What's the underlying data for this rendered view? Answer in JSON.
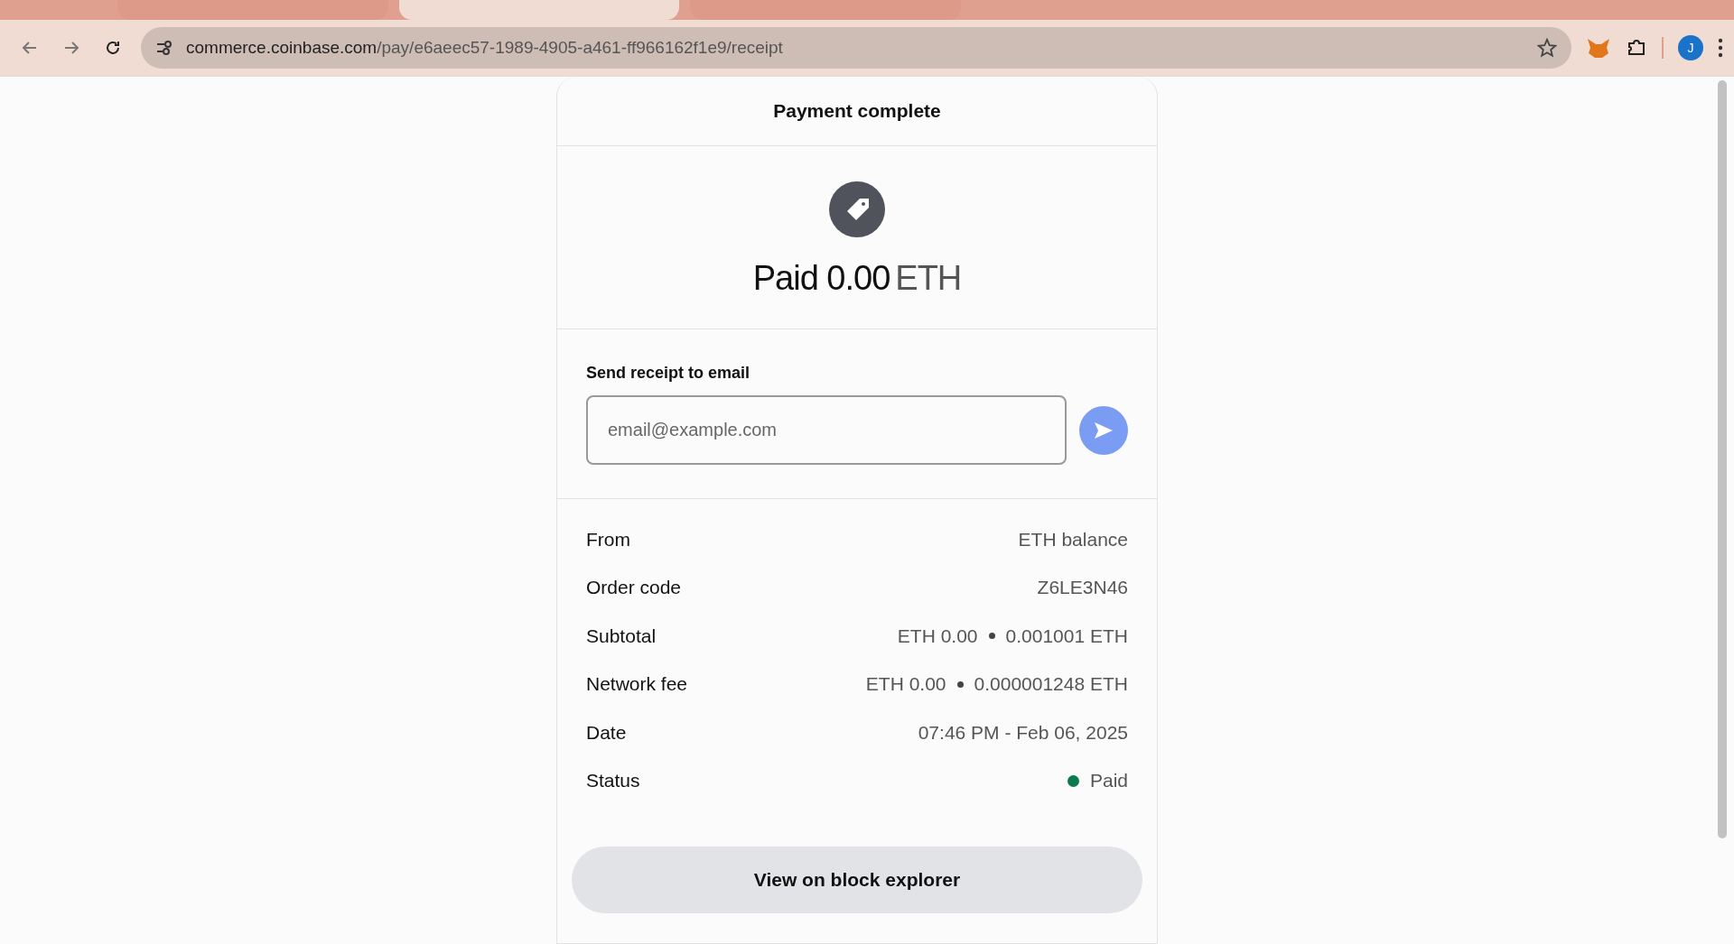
{
  "browser": {
    "tabs": [
      {
        "selected": false
      },
      {
        "selected": true
      },
      {
        "selected": false
      }
    ],
    "url_host": "commerce.coinbase.com",
    "url_path": "/pay/e6aeec57-1989-4905-a461-ff966162f1e9/receipt",
    "avatar": "J"
  },
  "card": {
    "title": "Payment complete",
    "amount_prefix": "Paid 0.00",
    "amount_currency": "ETH",
    "email_label": "Send receipt to email",
    "email_placeholder": "email@example.com",
    "details": [
      {
        "kind": "text",
        "label": "From",
        "value": "ETH balance"
      },
      {
        "kind": "text",
        "label": "Order code",
        "value": "Z6LE3N46"
      },
      {
        "kind": "pair",
        "label": "Subtotal",
        "value": "ETH 0.00",
        "value_2": "0.001001 ETH"
      },
      {
        "kind": "pair",
        "label": "Network fee",
        "value": "ETH 0.00",
        "value_2": "0.000001248 ETH"
      },
      {
        "kind": "text",
        "label": "Date",
        "value": "07:46 PM - Feb 06, 2025"
      },
      {
        "kind": "status",
        "label": "Status",
        "value": "Paid",
        "color": "#0b7a4e"
      }
    ],
    "button": "View on block explorer"
  }
}
